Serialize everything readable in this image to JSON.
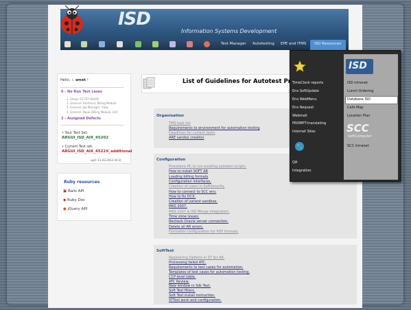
{
  "header": {
    "logo": "ISD",
    "subtitle": "Information Systems Development",
    "nav": [
      "Test Manager",
      "Autotesting",
      "EPE and ITMS",
      "ISD Resources"
    ]
  },
  "user": {
    "hello": "Hello,",
    "name": "amek",
    "no_run_label": "6 - No Run Test cases",
    "no_run_items": [
      "1. Setup: GC707-83095",
      "2. General: Electronic Billing Module",
      "3. General: Job Manager: View",
      "4. General: Paper Billing Module: GUI"
    ],
    "assigned": "2 - Assigned Defects",
    "your_test_set_label": "Your Test Set:",
    "your_test_set": "ARGUI_ISD_AIX_45202",
    "current_test_set_label": "Current Test set:",
    "current_test_set": "ARGUI_ISD_AIX_4522X_additional",
    "updated": "upd: 11-03-2012 (8:3)"
  },
  "ruby": {
    "title": "Ruby resources",
    "links": [
      "Rails API",
      "Ruby Doc",
      "jQuery API"
    ]
  },
  "main": {
    "title": "List of Guidelines for Autotest Program",
    "sections": [
      {
        "title": "Organisation",
        "links": [
          {
            "text": "TMS task list",
            "grey": true
          },
          {
            "text": "Requirements to environment for automation testing",
            "grey": false
          },
          {
            "text": "Deadlines for current tasks",
            "grey": true
          },
          {
            "text": "ARE sandox creation",
            "grey": false
          }
        ]
      },
      {
        "title": "Configuration",
        "links": [
          {
            "text": "Procedure PC to run existing autotest scripts.",
            "grey": true
          },
          {
            "text": "How to install SOFT AR",
            "grey": false
          },
          {
            "text": "Loading billing formats",
            "grey": false
          },
          {
            "text": "Configuration interfaces.",
            "grey": false
          },
          {
            "text": "Creation of users in SoftSecurity.",
            "grey": true
          },
          {
            "text": "How to connect to SCC env.",
            "grey": false
          },
          {
            "text": "How to fix DCX.",
            "grey": false
          },
          {
            "text": "Creation of varient sandbox.",
            "grey": false
          },
          {
            "text": "MKS 2007.",
            "grey": false
          },
          {
            "text": "MKS 2007 & ISD Merge integration.",
            "grey": true
          },
          {
            "text": "Time zone issues.",
            "grey": false
          },
          {
            "text": "Recheck Oracle server connection.",
            "grey": false
          },
          {
            "text": "Delete all AR errors.",
            "grey": false
          },
          {
            "text": "Formatter configuration for PDF formats.",
            "grey": true
          }
        ]
      },
      {
        "title": "SoftTest",
        "links": [
          {
            "text": "Registering Defects in ST for AR.",
            "grey": true
          },
          {
            "text": "Processing failed ATC.",
            "grey": false
          },
          {
            "text": "Requirements to test cases for automation.",
            "grey": false
          },
          {
            "text": "Templates of test cases for automation testing.",
            "grey": false
          },
          {
            "text": "CCP-level table.",
            "grey": false
          },
          {
            "text": "ATC Review.",
            "grey": false
          },
          {
            "text": "New window in Silk Test.",
            "grey": false
          },
          {
            "text": "Soft Test filters.",
            "grey": false
          },
          {
            "text": "Soft Test install instruction.",
            "grey": false
          },
          {
            "text": "STTool work and configuration.",
            "grey": false
          }
        ]
      }
    ]
  },
  "menu": {
    "left": [
      "TimeClock reports",
      "Env SoftUpdate",
      "Env WebMenu",
      "Env Request",
      "Webmail",
      "PROMPT-translating",
      "Internet Sites",
      "QA",
      "Integration"
    ],
    "right_logo": "ISD",
    "right": [
      "ISD intranet",
      "Lunch Ordering",
      "Database ISD",
      "Cafe Map",
      "Location Plan"
    ],
    "scc_logo": "SCC",
    "scc_sub": "SoftComputer",
    "scc_link": "SCC intranet"
  }
}
